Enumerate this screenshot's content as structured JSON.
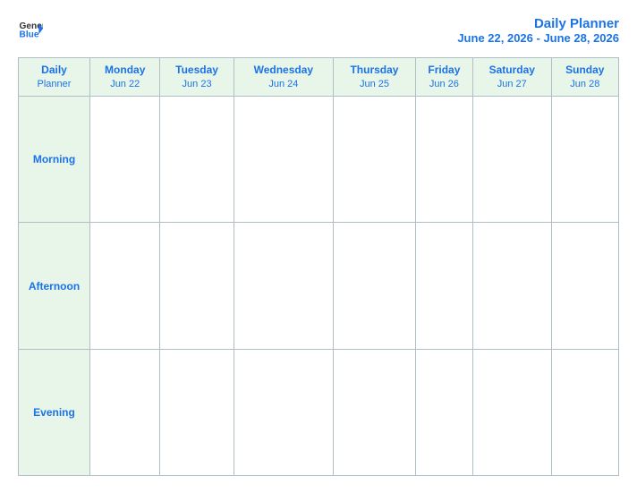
{
  "header": {
    "logo": {
      "general": "General",
      "blue": "Blue"
    },
    "title": "Daily Planner",
    "date_range": "June 22, 2026 - June 28, 2026"
  },
  "table": {
    "header_label_line1": "Daily",
    "header_label_line2": "Planner",
    "columns": [
      {
        "day": "Monday",
        "date": "Jun 22"
      },
      {
        "day": "Tuesday",
        "date": "Jun 23"
      },
      {
        "day": "Wednesday",
        "date": "Jun 24"
      },
      {
        "day": "Thursday",
        "date": "Jun 25"
      },
      {
        "day": "Friday",
        "date": "Jun 26"
      },
      {
        "day": "Saturday",
        "date": "Jun 27"
      },
      {
        "day": "Sunday",
        "date": "Jun 28"
      }
    ],
    "rows": [
      {
        "label": "Morning"
      },
      {
        "label": "Afternoon"
      },
      {
        "label": "Evening"
      }
    ]
  }
}
